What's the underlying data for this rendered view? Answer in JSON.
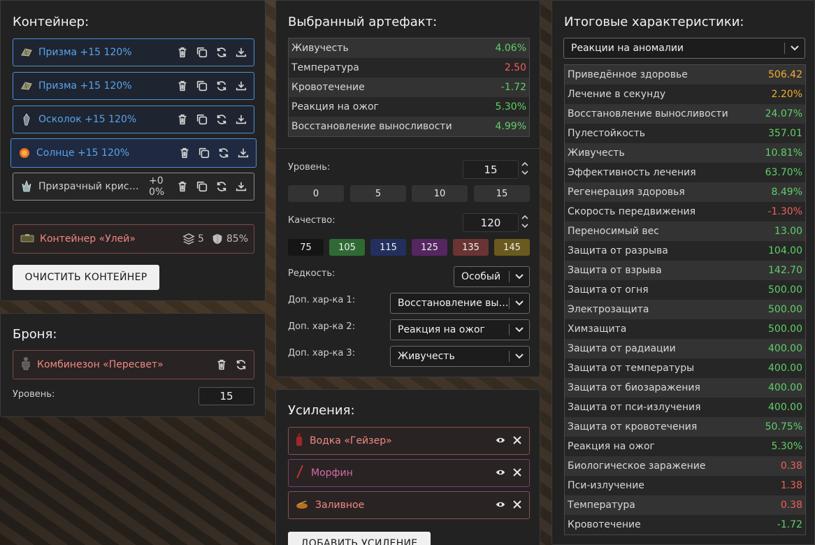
{
  "container": {
    "title": "Контейнер:",
    "slots": [
      {
        "label": "Призма +15 120%"
      },
      {
        "label": "Призма +15 120%"
      },
      {
        "label": "Осколок +15 120%"
      },
      {
        "label": "Солнце +15 120%"
      },
      {
        "label": "Призрачный кристалл",
        "extra": "+0 0%"
      }
    ],
    "case": {
      "label": "Контейнер «Улей»",
      "capacity": "5",
      "protection": "85%"
    },
    "clear_label": "ОЧИСТИТЬ КОНТЕЙНЕР"
  },
  "armor": {
    "title": "Броня:",
    "item_label": "Комбинезон «Пересвет»",
    "level_label": "Уровень:",
    "level_value": "15"
  },
  "artifact": {
    "title": "Выбранный артефакт:",
    "stats": [
      {
        "name": "Живучесть",
        "value": "4.06%",
        "tone": "pos"
      },
      {
        "name": "Температура",
        "value": "2.50",
        "tone": "neg"
      },
      {
        "name": "Кровотечение",
        "value": "-1.72",
        "tone": "pos"
      },
      {
        "name": "Реакция на ожог",
        "value": "5.30%",
        "tone": "pos"
      },
      {
        "name": "Восстановление выносливости",
        "value": "4.99%",
        "tone": "pos"
      }
    ],
    "level_label": "Уровень:",
    "level_value": "15",
    "level_presets": [
      "0",
      "5",
      "10",
      "15"
    ],
    "quality_label": "Качество:",
    "quality_value": "120",
    "quality_presets": [
      {
        "label": "75",
        "color": "#151515"
      },
      {
        "label": "105",
        "color": "#2f6a34"
      },
      {
        "label": "115",
        "color": "#23305e"
      },
      {
        "label": "125",
        "color": "#552660"
      },
      {
        "label": "135",
        "color": "#6a3434"
      },
      {
        "label": "145",
        "color": "#6a5a1e"
      }
    ],
    "rarity_label": "Редкость:",
    "rarity_value": "Особый",
    "extra1_label": "Доп. хар-ка 1:",
    "extra1_value": "Восстановление выносливости",
    "extra2_label": "Доп. хар-ка 2:",
    "extra2_value": "Реакция на ожог",
    "extra3_label": "Доп. хар-ка 3:",
    "extra3_value": "Живучесть"
  },
  "boosts": {
    "title": "Усиления:",
    "items": [
      {
        "label": "Водка «Гейзер»",
        "color": "#ee8a82",
        "border": "#8a5050"
      },
      {
        "label": "Морфин",
        "color": "#d46aa8",
        "border": "#7a4070"
      },
      {
        "label": "Заливное",
        "color": "#ee8a82",
        "border": "#8a5050"
      }
    ],
    "add_label": "ДОБАВИТЬ УСИЛЕНИЕ"
  },
  "totals": {
    "title": "Итоговые характеристики:",
    "filter_value": "Реакции на аномалии",
    "rows": [
      {
        "name": "Приведённое здоровье",
        "value": "506.42",
        "tone": "warn"
      },
      {
        "name": "Лечение в секунду",
        "value": "2.20%",
        "tone": "warn"
      },
      {
        "name": "Восстановление выносливости",
        "value": "24.07%",
        "tone": "pos"
      },
      {
        "name": "Пулестойкость",
        "value": "357.01",
        "tone": "pos"
      },
      {
        "name": "Живучесть",
        "value": "10.81%",
        "tone": "pos"
      },
      {
        "name": "Эффективность лечения",
        "value": "63.70%",
        "tone": "pos"
      },
      {
        "name": "Регенерация здоровья",
        "value": "8.49%",
        "tone": "pos"
      },
      {
        "name": "Скорость передвижения",
        "value": "-1.30%",
        "tone": "neg"
      },
      {
        "name": "Переносимый вес",
        "value": "13.00",
        "tone": "pos"
      },
      {
        "name": "Защита от разрыва",
        "value": "104.00",
        "tone": "pos"
      },
      {
        "name": "Защита от взрыва",
        "value": "142.70",
        "tone": "pos"
      },
      {
        "name": "Защита от огня",
        "value": "500.00",
        "tone": "pos"
      },
      {
        "name": "Электрозащита",
        "value": "500.00",
        "tone": "pos"
      },
      {
        "name": "Химзащита",
        "value": "500.00",
        "tone": "pos"
      },
      {
        "name": "Защита от радиации",
        "value": "400.00",
        "tone": "pos"
      },
      {
        "name": "Защита от температуры",
        "value": "400.00",
        "tone": "pos"
      },
      {
        "name": "Защита от биозаражения",
        "value": "400.00",
        "tone": "pos"
      },
      {
        "name": "Защита от пси-излучения",
        "value": "400.00",
        "tone": "pos"
      },
      {
        "name": "Защита от кровотечения",
        "value": "50.75%",
        "tone": "pos"
      },
      {
        "name": "Реакция на ожог",
        "value": "5.30%",
        "tone": "pos"
      },
      {
        "name": "Биологическое заражение",
        "value": "0.38",
        "tone": "neg"
      },
      {
        "name": "Пси-излучение",
        "value": "1.38",
        "tone": "neg"
      },
      {
        "name": "Температура",
        "value": "0.38",
        "tone": "neg"
      },
      {
        "name": "Кровотечение",
        "value": "-1.72",
        "tone": "pos"
      }
    ]
  }
}
